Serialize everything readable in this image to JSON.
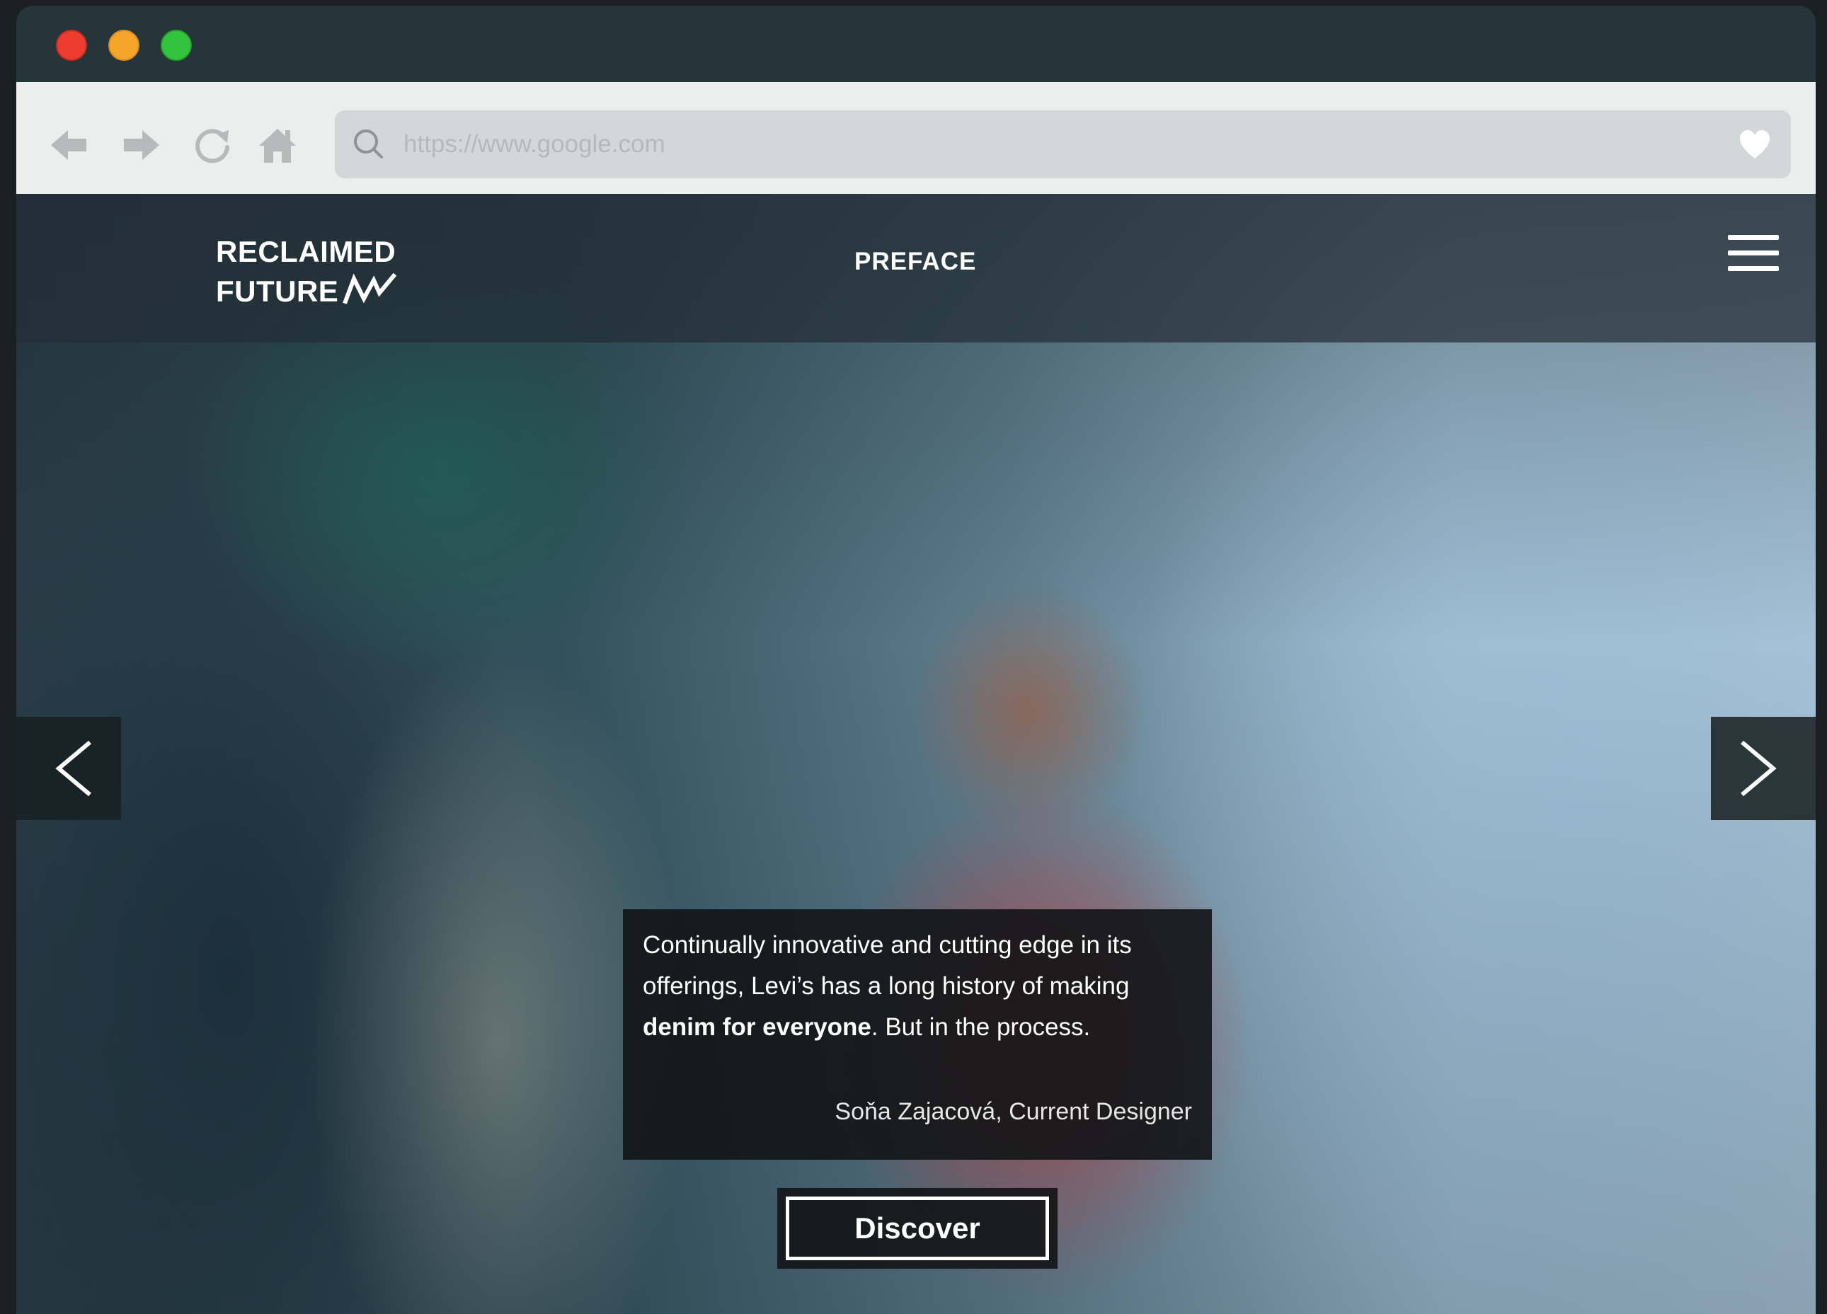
{
  "browser": {
    "window_controls": [
      "close",
      "minimize",
      "maximize"
    ],
    "toolbar": {
      "buttons": [
        {
          "name": "back",
          "icon": "arrow-left-icon"
        },
        {
          "name": "forward",
          "icon": "arrow-right-icon"
        },
        {
          "name": "reload",
          "icon": "reload-icon"
        },
        {
          "name": "home",
          "icon": "home-icon"
        }
      ]
    },
    "address_bar": {
      "url": "https://www.google.com",
      "left_icon": "search-icon",
      "right_icon": "heart-icon"
    }
  },
  "site": {
    "brand": {
      "line1": "RECLAIMED",
      "line2": "FUTURE",
      "mark_icon": "zigzag-mark-icon"
    },
    "nav": {
      "preface_label": "PREFACE",
      "menu_icon": "hamburger-menu-icon"
    },
    "slider": {
      "prev_icon": "chevron-left-icon",
      "next_icon": "chevron-right-icon"
    },
    "quote": {
      "text_before": "Continually innovative and cutting edge in its offerings, Levi’s has a long history of making ",
      "text_bold": "denim for everyone",
      "text_after": ". But in the process.",
      "author": "Soňa Zajacová, Current Designer"
    },
    "cta": {
      "label": "Discover"
    }
  },
  "colors": {
    "titlebar": "#26353a",
    "toolbar": "#eceeee",
    "urlbar": "#d4d7d8",
    "close": "#ee3b2f",
    "minimize": "#f7a52a",
    "maximize": "#34c33c",
    "overlay_dark": "#121415"
  }
}
